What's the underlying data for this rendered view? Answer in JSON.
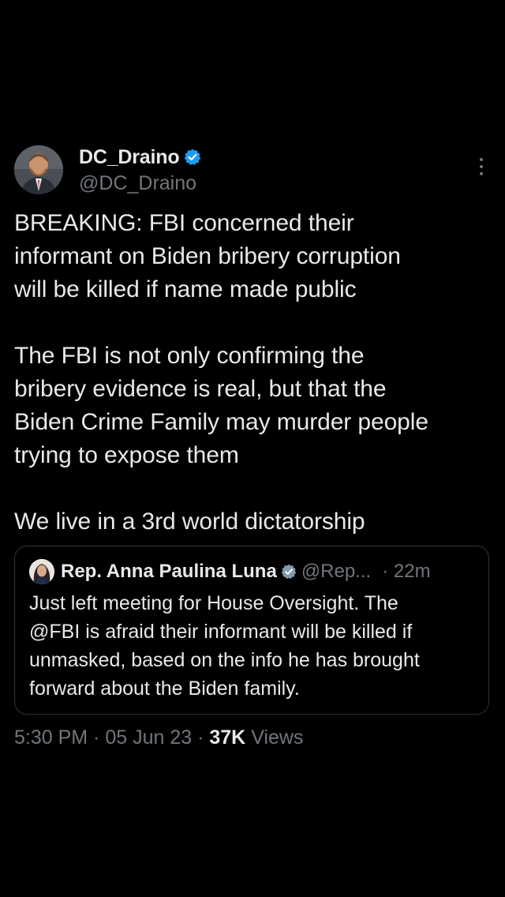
{
  "tweet": {
    "author": {
      "display_name": "DC_Draino",
      "handle": "@DC_Draino",
      "verified_icon": "verified-badge-icon",
      "avatar": "avatar-photo"
    },
    "more_icon": "more-vertical-icon",
    "text": "BREAKING: FBI concerned their\ninformant on Biden bribery corruption\nwill be killed if name made public\n\nThe FBI is not only confirming the\nbribery evidence is real, but that the\nBiden Crime Family may murder people\ntrying to expose them\n\nWe live in a 3rd world dictatorship",
    "quoted": {
      "display_name": "Rep. Anna Paulina Luna",
      "handle": "@Rep...",
      "time": "· 22m",
      "text": "Just left meeting for House Oversight. The\n@FBI is afraid their informant will be killed if\nunmasked, based on the info he has brought\nforward about the Biden family."
    },
    "meta": {
      "time": "5:30 PM",
      "sep1": " · ",
      "date": "05 Jun 23",
      "sep2": " · ",
      "views_count": "37K",
      "views_label": " Views"
    }
  },
  "colors": {
    "background": "#000000",
    "primary_text": "#e7e9ea",
    "secondary_text": "#71767b",
    "verified": "#1d9bf0",
    "border": "#2f3336"
  }
}
